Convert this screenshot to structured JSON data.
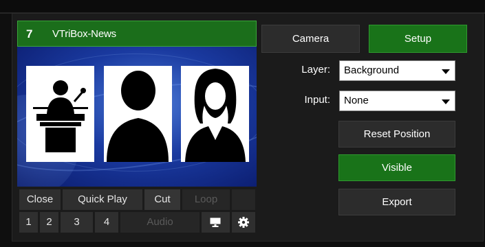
{
  "input": {
    "number": "7",
    "name": "VTriBox-News"
  },
  "controls": {
    "row1": [
      "Close",
      "Quick Play",
      "Cut",
      "Loop",
      ""
    ],
    "row2": [
      "1",
      "2",
      "3",
      "4",
      "Audio"
    ],
    "row2_icons": [
      "monitor-icon",
      "gear-icon"
    ]
  },
  "right": {
    "camera": "Camera",
    "setup": "Setup",
    "layer_label": "Layer:",
    "layer_value": "Background",
    "input_label": "Input:",
    "input_value": "None",
    "reset": "Reset Position",
    "visible": "Visible",
    "export": "Export"
  },
  "colors": {
    "accent_green": "#197319",
    "panel": "#1b1b1b",
    "button_gray": "#2c2c2c"
  }
}
